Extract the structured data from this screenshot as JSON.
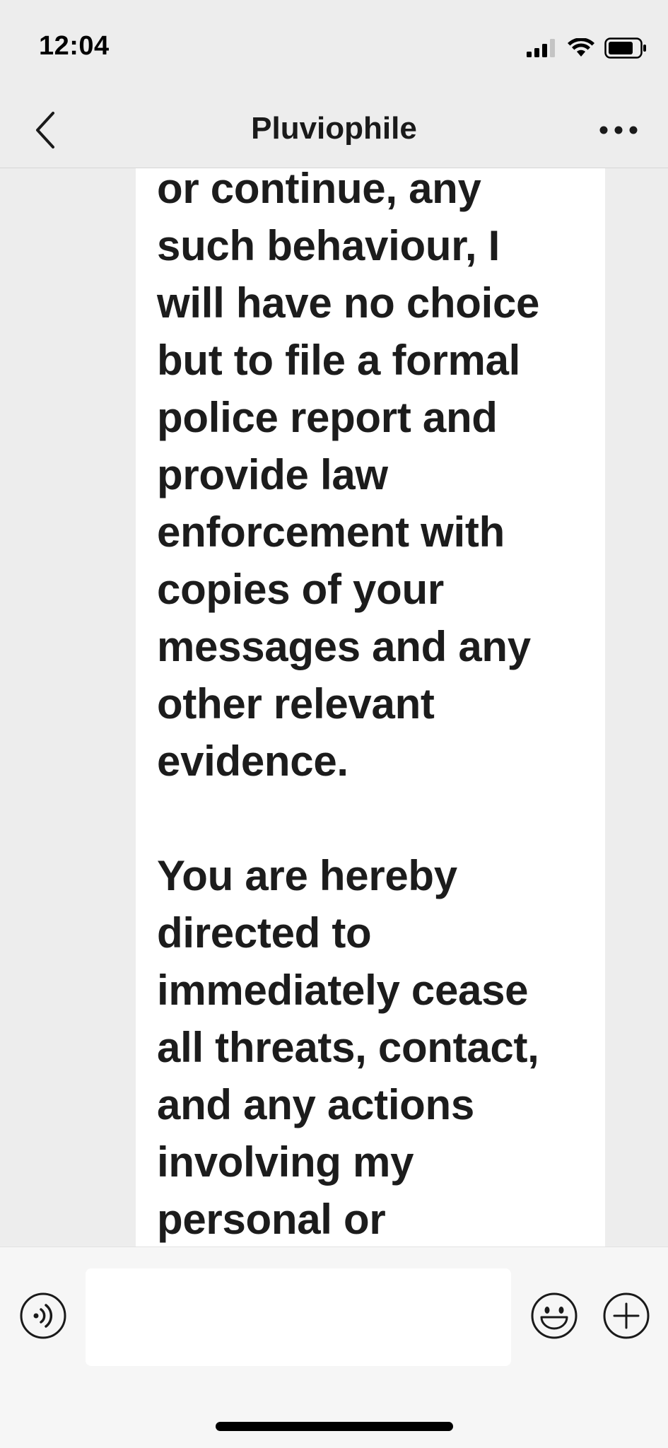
{
  "status_bar": {
    "time": "12:04",
    "icons": [
      "signal-icon",
      "wifi-icon",
      "battery-icon"
    ]
  },
  "nav": {
    "title": "Pluviophile",
    "back_icon": "chevron-left-icon",
    "more_icon": "more-horizontal-icon"
  },
  "chat": {
    "message": {
      "text": "or continue, any\nsuch behaviour, I\nwill have no choice\nbut to file a formal\npolice report and\nprovide law\nenforcement with\ncopies of your\nmessages and any\nother relevant\nevidence.\n\nYou are hereby\ndirected to\nimmediately cease\nall threats, contact,\nand any actions\ninvolving my\npersonal or"
    }
  },
  "input_bar": {
    "input_value": "",
    "voice_icon": "voice-icon",
    "emoji_icon": "emoji-icon",
    "plus_icon": "plus-circle-icon"
  },
  "colors": {
    "background": "#ededed",
    "bubble": "#ffffff",
    "text": "#1c1c1c"
  }
}
